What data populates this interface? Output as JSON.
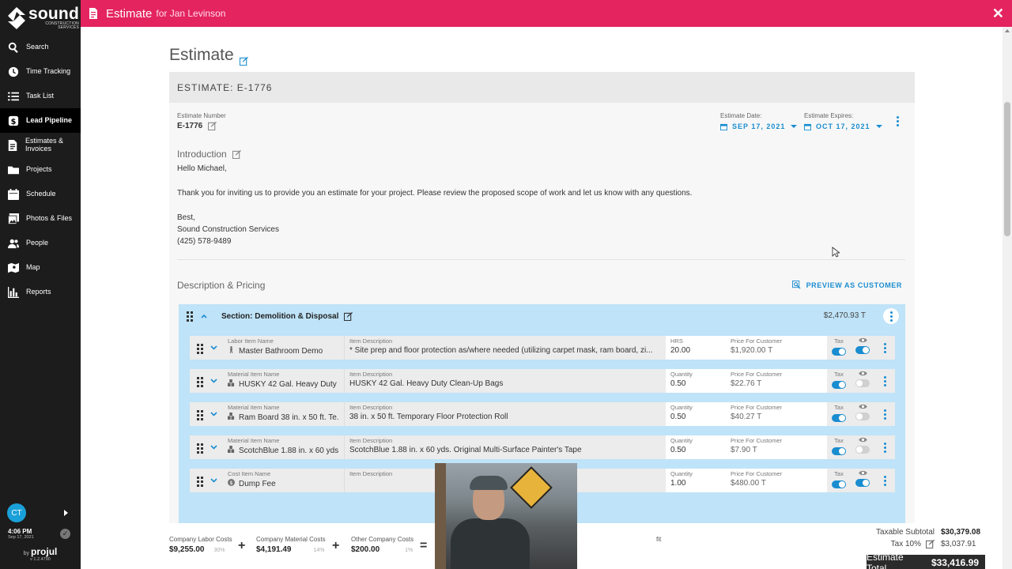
{
  "sidebar": {
    "logo_word": "sound",
    "logo_sub_1": "CONSTRUCTION",
    "logo_sub_2": "SERVICES",
    "items": [
      {
        "label": "Search"
      },
      {
        "label": "Time Tracking"
      },
      {
        "label": "Task List"
      },
      {
        "label": "Lead Pipeline"
      },
      {
        "label": "Estimates & Invoices"
      },
      {
        "label": "Projects"
      },
      {
        "label": "Schedule"
      },
      {
        "label": "Photos & Files"
      },
      {
        "label": "People"
      },
      {
        "label": "Map"
      },
      {
        "label": "Reports"
      }
    ],
    "active_item": "Lead Pipeline",
    "avatar_initials": "CT",
    "time": "4:06 PM",
    "date": "Sep 17, 2021",
    "brand_by": "by",
    "brand": "projul",
    "version": "v 1.2.4790"
  },
  "header": {
    "title": "Estimate",
    "for": "for Jan Levinson",
    "accent": "#e4245f"
  },
  "page": {
    "title": "Estimate"
  },
  "estimate": {
    "heading": "ESTIMATE: E-1776",
    "number_label": "Estimate Number",
    "number": "E-1776",
    "date_label": "Estimate Date:",
    "date": "SEP 17, 2021",
    "expires_label": "Estimate Expires:",
    "expires": "OCT 17, 2021",
    "intro_title": "Introduction",
    "intro_body": "Hello Michael,\n\nThank you for inviting us to provide you an estimate for your project. Please review the proposed scope of work and let us know with any questions.\n\nBest,\nSound Construction Services\n(425) 578-9489",
    "pricing_title": "Description & Pricing",
    "preview_label": "PREVIEW AS CUSTOMER"
  },
  "section": {
    "title": "Section: Demolition & Disposal",
    "total": "$2,470.93 T",
    "lines": [
      {
        "name_label": "Labor Item Name",
        "name": "Master Bathroom Demo",
        "type_icon": "person-icon",
        "desc_label": "Item Description",
        "desc": "* Site prep and floor protection as/where needed (utilizing carpet mask, ram board, zi...",
        "qty_label": "HRS",
        "qty": "20.00",
        "price_label": "Price For Customer",
        "price": "$1,920.00 T",
        "tax_label": "Tax",
        "tax_on": true,
        "visible_on": true
      },
      {
        "name_label": "Material Item Name",
        "name": "HUSKY 42 Gal. Heavy Duty ...",
        "type_icon": "material-icon",
        "desc_label": "Item Description",
        "desc": "HUSKY 42 Gal. Heavy Duty Clean-Up Bags",
        "qty_label": "Quantity",
        "qty": "0.50",
        "price_label": "Price For Customer",
        "price": "$22.76 T",
        "tax_label": "Tax",
        "tax_on": true,
        "visible_on": false
      },
      {
        "name_label": "Material Item Name",
        "name": "Ram Board 38 in. x 50 ft. Te...",
        "type_icon": "material-icon",
        "desc_label": "Item Description",
        "desc": "38 in. x 50 ft. Temporary Floor Protection Roll",
        "qty_label": "Quantity",
        "qty": "0.50",
        "price_label": "Price For Customer",
        "price": "$40.27 T",
        "tax_label": "Tax",
        "tax_on": true,
        "visible_on": false
      },
      {
        "name_label": "Material Item Name",
        "name": "ScotchBlue 1.88 in. x 60 yds...",
        "type_icon": "material-icon",
        "desc_label": "Item Description",
        "desc": "ScotchBlue 1.88 in. x 60 yds. Original Multi-Surface Painter's Tape",
        "qty_label": "Quantity",
        "qty": "0.50",
        "price_label": "Price For Customer",
        "price": "$7.90 T",
        "tax_label": "Tax",
        "tax_on": true,
        "visible_on": false
      },
      {
        "name_label": "Cost Item Name",
        "name": "Dump Fee",
        "type_icon": "dollar-icon",
        "desc_label": "Item Description",
        "desc": "",
        "qty_label": "Quantity",
        "qty": "1.00",
        "price_label": "Price For Customer",
        "price": "$480.00 T",
        "tax_label": "Tax",
        "tax_on": true,
        "visible_on": true
      }
    ]
  },
  "footer": {
    "labor_label": "Company Labor Costs",
    "labor": "$9,255.00",
    "labor_pct": "30%",
    "material_label": "Company Material Costs",
    "material": "$4,191.49",
    "material_pct": "14%",
    "other_label": "Other Company Costs",
    "other": "$200.00",
    "other_pct": "1%",
    "op_plus": "+",
    "op_equals": "=",
    "partial_label": "fit",
    "taxable_label": "Taxable Subtotal",
    "taxable": "$30,379.08",
    "tax_label": "Tax 10%",
    "tax": "$3,037.91",
    "total_label": "Estimate Total",
    "total": "$33,416.99"
  }
}
